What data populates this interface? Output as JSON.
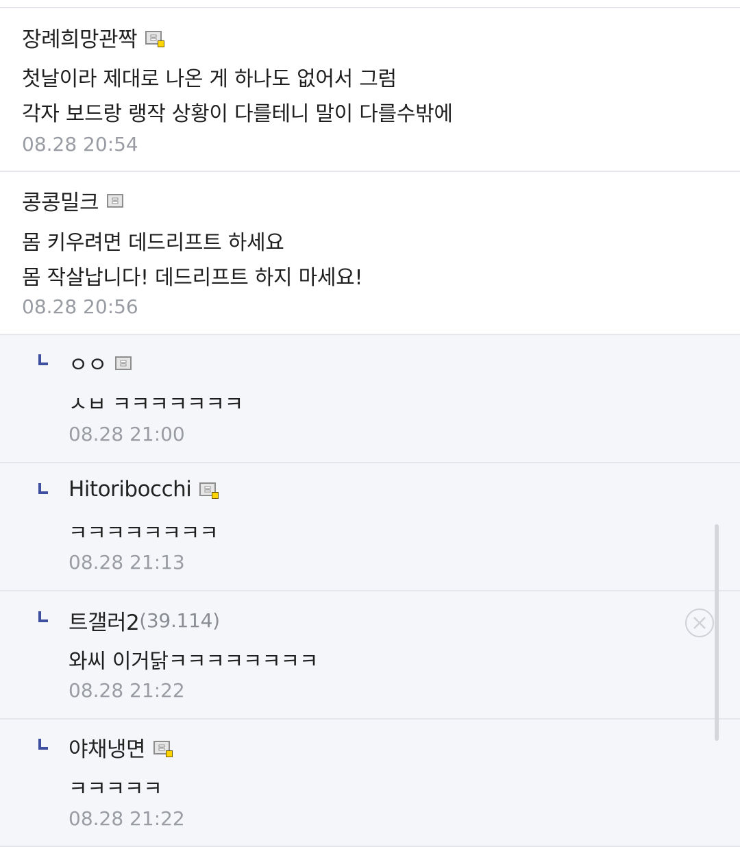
{
  "comments": [
    {
      "nickname": "장례희망관짝",
      "badge": "gallery-member-icon-with-yellow-dot",
      "lines": [
        "첫날이라 제대로 나온 게 하나도 없어서 그럼",
        "각자 보드랑 랭작 상황이 다를테니 말이 다를수밖에"
      ],
      "time": "08.28 20:54"
    },
    {
      "nickname": "콩콩밀크",
      "badge": "gallery-member-icon",
      "lines": [
        "몸 키우려면 데드리프트 하세요",
        "몸 작살납니다! 데드리프트 하지 마세요!"
      ],
      "time": "08.28 20:56"
    }
  ],
  "replies": [
    {
      "nickname": "ㅇㅇ",
      "badge": "gallery-member-icon",
      "text": "ㅅㅂ ㅋㅋㅋㅋㅋㅋㅋ",
      "time": "08.28 21:00"
    },
    {
      "nickname": "Hitoribocchi",
      "badge": "gallery-member-icon-with-yellow-dot",
      "text": "ㅋㅋㅋㅋㅋㅋㅋㅋ",
      "time": "08.28 21:13"
    },
    {
      "nickname": "트갤러2",
      "ip": "(39.114)",
      "text": "와씨 이거닭ㅋㅋㅋㅋㅋㅋㅋㅋ",
      "time": "08.28 21:22"
    },
    {
      "nickname": "야채냉면",
      "badge": "gallery-member-icon-with-yellow-dot",
      "text": "ㅋㅋㅋㅋㅋ",
      "time": "08.28 21:22"
    }
  ],
  "colors": {
    "reply_background": "#f5f6fa",
    "reply_marker": "#3d4f9e",
    "timestamp": "#9a9ca4",
    "divider": "#e4e6ec"
  },
  "icons": {
    "reply_marker": "reply-arrow-icon",
    "delete": "close-circle-icon"
  }
}
